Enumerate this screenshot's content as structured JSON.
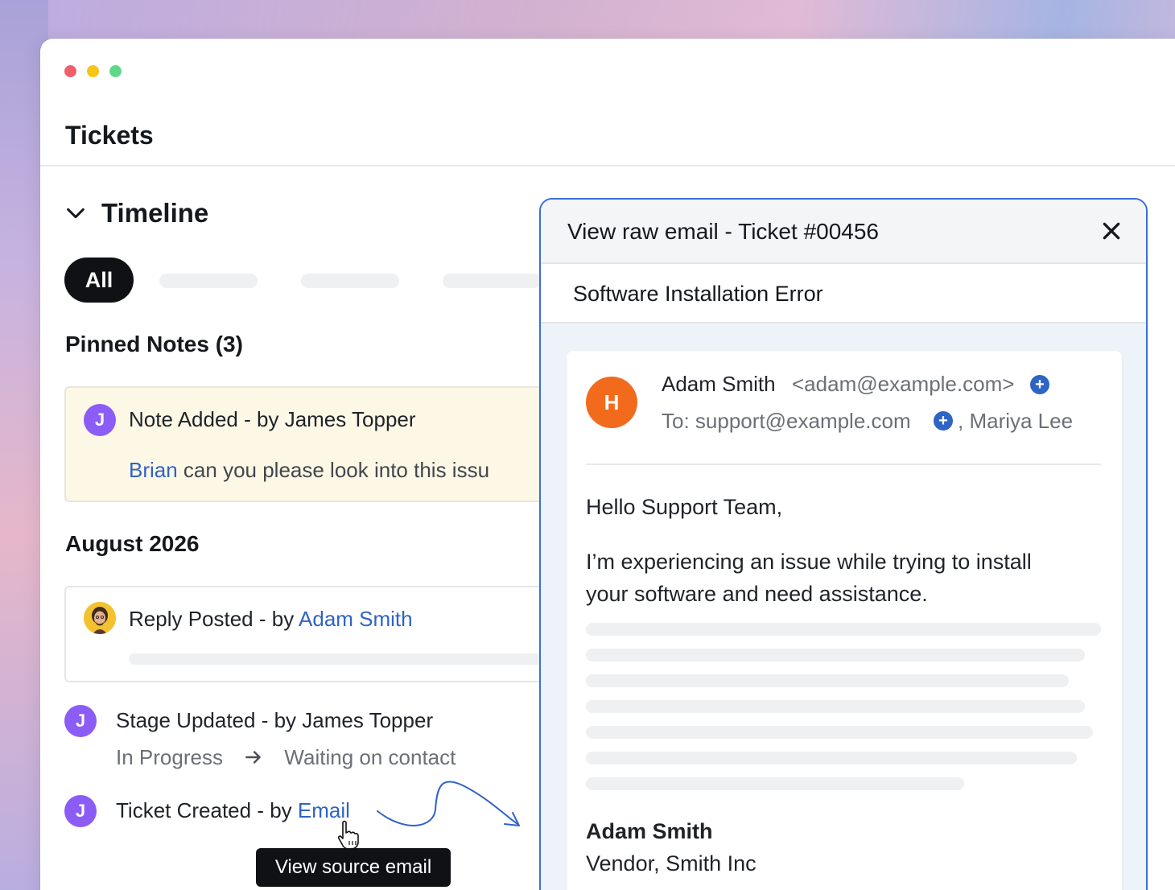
{
  "window": {
    "title": "Tickets",
    "controls": [
      "close",
      "minimize",
      "maximize"
    ]
  },
  "timeline": {
    "title": "Timeline",
    "filter_tabs": [
      {
        "label": "All",
        "active": true
      }
    ]
  },
  "pinned_notes": {
    "heading": "Pinned Notes (3)",
    "note": {
      "avatar_initial": "J",
      "event": "Note Added",
      "separator": " - by ",
      "author": "James Topper",
      "mention": "Brian",
      "body": " can you please look into this issu"
    }
  },
  "month_group": {
    "heading": "August 2026",
    "reply": {
      "event": "Reply Posted",
      "separator": " - by ",
      "author": "Adam Smith"
    },
    "stage_update": {
      "avatar_initial": "J",
      "event": "Stage Updated",
      "separator": " - by ",
      "author": "James Topper",
      "from_stage": "In Progress",
      "to_stage": "Waiting on contact"
    },
    "ticket_created": {
      "avatar_initial": "J",
      "event": "Ticket Created",
      "separator": " - by ",
      "source": "Email"
    }
  },
  "tooltip": "View source email",
  "modal": {
    "title": "View raw email - Ticket #00456",
    "subject": "Software Installation Error",
    "email": {
      "avatar_initial": "H",
      "from_name": "Adam Smith",
      "from_address": "<adam@example.com>",
      "to_label": "To: support@example.com",
      "cc_name": ", Mariya Lee",
      "greeting": "Hello Support Team,",
      "body_line1": "I’m experiencing an issue while trying to install",
      "body_line2": "your software and need assistance.",
      "signature_name": "Adam Smith",
      "signature_company": "Vendor, Smith Inc"
    }
  },
  "colors": {
    "accent": "#2f63c4",
    "avatar_purple": "#8b5cf6",
    "avatar_orange": "#f26b1d",
    "modal_border": "#3b6fd8",
    "note_bg": "#fdf8e6"
  },
  "icons": [
    "chevron-down-icon",
    "close-icon",
    "plus-circle-icon",
    "arrow-right-icon",
    "hand-cursor-icon",
    "curved-arrow-icon"
  ]
}
